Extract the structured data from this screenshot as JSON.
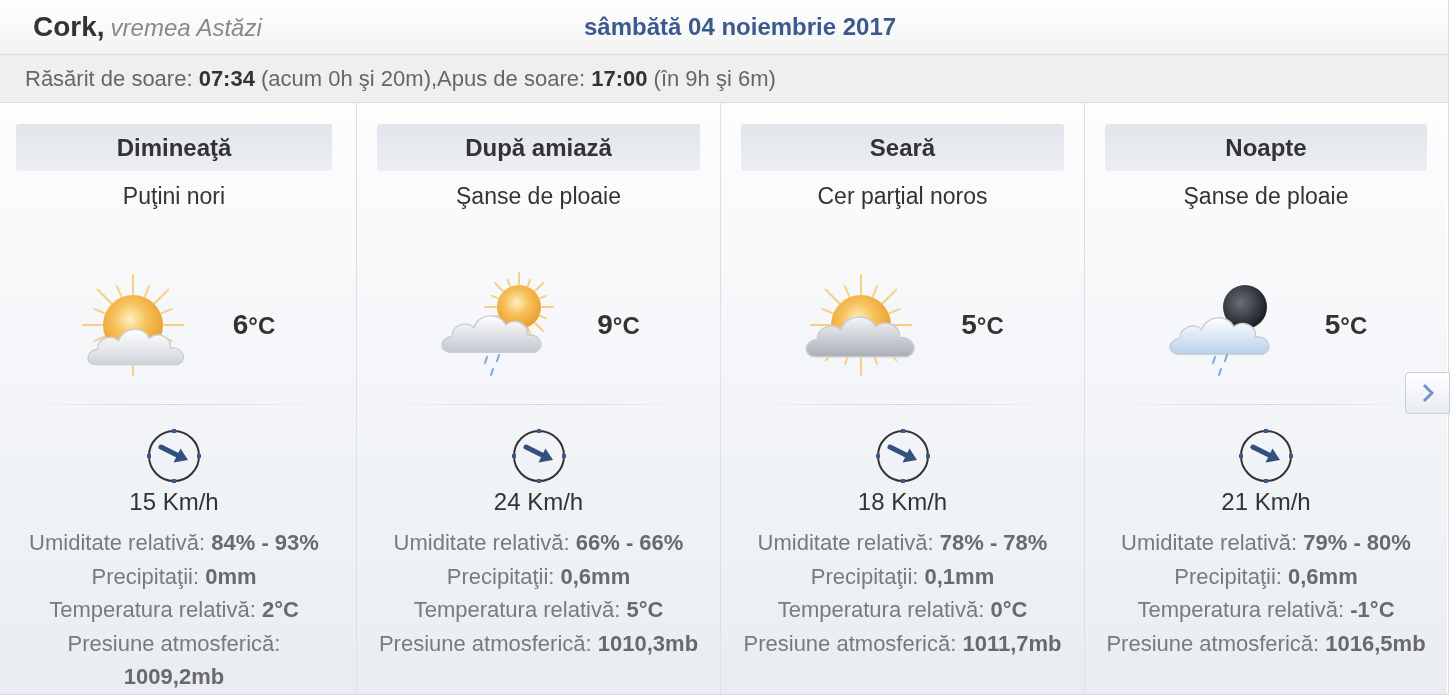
{
  "header": {
    "city": "Cork,",
    "subtitle": "vremea Astăzi",
    "date": "sâmbătă 04 noiembrie 2017"
  },
  "sun_bar": {
    "text": "Răsărit de soare: **07:34** (acum 0h şi 20m),Apus de soare: **17:00** (în 9h şi 6m)"
  },
  "periods": [
    {
      "title": "Dimineaţă",
      "condition": "Puţini nori",
      "kind": "sun_cloud",
      "temperature": "6",
      "unit": "°C",
      "wind_speed": "15 Km/h",
      "details": [
        {
          "label": "Umiditate relativă:",
          "value": "84% - 93%"
        },
        {
          "label": "Precipitaţii:",
          "value": "0mm"
        },
        {
          "label": "Temperatura relativă:",
          "value": "2°C"
        },
        {
          "label": "Presiune atmosferică:",
          "value": "1009,2mb"
        }
      ]
    },
    {
      "title": "După amiază",
      "condition": "Şanse de ploaie",
      "kind": "sun_cloud_rain",
      "temperature": "9",
      "unit": "°C",
      "wind_speed": "24 Km/h",
      "details": [
        {
          "label": "Umiditate relativă:",
          "value": "66% - 66%"
        },
        {
          "label": "Precipitaţii:",
          "value": "0,6mm"
        },
        {
          "label": "Temperatura relativă:",
          "value": "5°C"
        },
        {
          "label": "Presiune atmosferică:",
          "value": "1010,3mb"
        }
      ]
    },
    {
      "title": "Seară",
      "condition": "Cer parţial noros",
      "kind": "cloud_sun",
      "temperature": "5",
      "unit": "°C",
      "wind_speed": "18 Km/h",
      "details": [
        {
          "label": "Umiditate relativă:",
          "value": "78% - 78%"
        },
        {
          "label": "Precipitaţii:",
          "value": "0,1mm"
        },
        {
          "label": "Temperatura relativă:",
          "value": "0°C"
        },
        {
          "label": "Presiune atmosferică:",
          "value": "1011,7mb"
        }
      ]
    },
    {
      "title": "Noapte",
      "condition": "Şanse de ploaie",
      "kind": "moon_cloud_rain",
      "temperature": "5",
      "unit": "°C",
      "wind_speed": "21 Km/h",
      "details": [
        {
          "label": "Umiditate relativă:",
          "value": "79% - 80%"
        },
        {
          "label": "Precipitaţii:",
          "value": "0,6mm"
        },
        {
          "label": "Temperatura relativă:",
          "value": "-1°C"
        },
        {
          "label": "Presiune atmosferică:",
          "value": "1016,5mb"
        }
      ]
    }
  ]
}
